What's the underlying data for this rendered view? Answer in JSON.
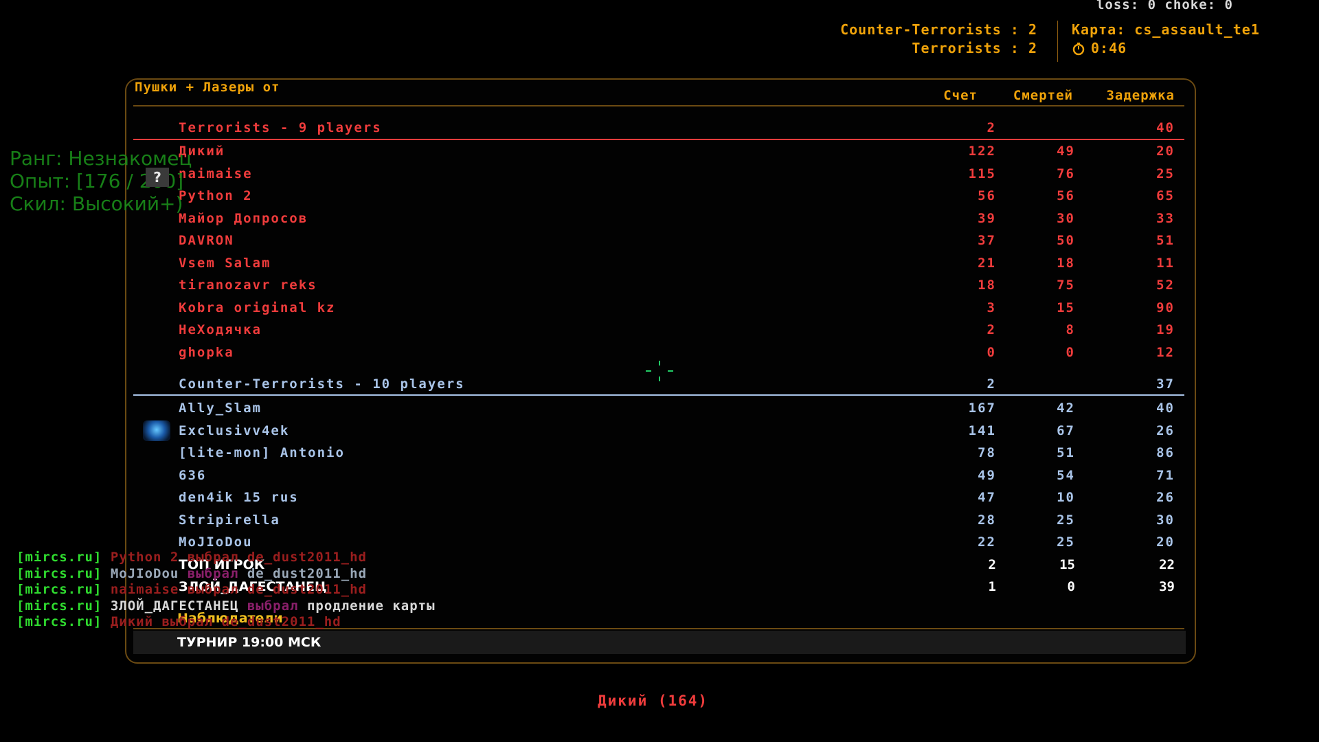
{
  "hud": {
    "net_stats": "loss: 0 choke:  0",
    "ct_count": "Counter-Terrorists : 2",
    "t_count": "Terrorists : 2",
    "map": "Карта: cs_assault_te1",
    "timer": "0:46"
  },
  "scoreboard": {
    "title": "Пушки + Лазеры от",
    "columns": {
      "score": "Счет",
      "deaths": "Смертей",
      "latency": "Задержка"
    },
    "terrorists": {
      "label": "Terrorists   -   9 players",
      "score": "2",
      "latency": "40",
      "players": [
        {
          "name": "Дикий",
          "score": "122",
          "deaths": "49",
          "latency": "20"
        },
        {
          "name": "naimaise",
          "score": "115",
          "deaths": "76",
          "latency": "25"
        },
        {
          "name": "Python 2",
          "score": "56",
          "deaths": "56",
          "latency": "65"
        },
        {
          "name": "Майор Допросов",
          "score": "39",
          "deaths": "30",
          "latency": "33"
        },
        {
          "name": "DAVRON",
          "score": "37",
          "deaths": "50",
          "latency": "51"
        },
        {
          "name": "Vsem Salam",
          "score": "21",
          "deaths": "18",
          "latency": "11"
        },
        {
          "name": "tiranozavr reks",
          "score": "18",
          "deaths": "75",
          "latency": "52"
        },
        {
          "name": "Kobra original kz",
          "score": "3",
          "deaths": "15",
          "latency": "90"
        },
        {
          "name": "НеХодячка",
          "score": "2",
          "deaths": "8",
          "latency": "19"
        },
        {
          "name": "ghopka",
          "score": "0",
          "deaths": "0",
          "latency": "12"
        }
      ]
    },
    "counter_terrorists": {
      "label": "Counter-Terrorists   -   10 players",
      "score": "2",
      "latency": "37",
      "players": [
        {
          "name": "Ally_Slam",
          "score": "167",
          "deaths": "42",
          "latency": "40"
        },
        {
          "name": "Exclusivv4ek",
          "score": "141",
          "deaths": "67",
          "latency": "26"
        },
        {
          "name": "[lite-mon] Antonio",
          "score": "78",
          "deaths": "51",
          "latency": "86"
        },
        {
          "name": "636",
          "score": "49",
          "deaths": "54",
          "latency": "71"
        },
        {
          "name": "den4ik 15 rus",
          "score": "47",
          "deaths": "10",
          "latency": "26"
        },
        {
          "name": "Stripirella",
          "score": "28",
          "deaths": "25",
          "latency": "30"
        },
        {
          "name": "MoJIoDou",
          "score": "22",
          "deaths": "25",
          "latency": "20"
        },
        {
          "name": "ТОП ИГРОК",
          "score": "2",
          "deaths": "15",
          "latency": "22"
        },
        {
          "name": "ЗЛОЙ_ДАГЕСТАНЕЦ",
          "score": "1",
          "deaths": "0",
          "latency": "39"
        }
      ]
    },
    "spectators_label": "Наблюдатели",
    "footer": "ТУРНИР 19:00 МСК"
  },
  "rank_overlay": {
    "rank": "Ранг: Незнакомец",
    "exp": "Опыт: [176 / 200]",
    "skill": "Скил: Высокий+)",
    "help": "?"
  },
  "chat": [
    {
      "tag": "[mircs.ru]",
      "parts": [
        {
          "text": " Python 2 выбрал de_dust2011_hd",
          "style": "red"
        }
      ]
    },
    {
      "tag": "[mircs.ru]",
      "parts": [
        {
          "text": " MoJIoDou",
          "style": "grey"
        },
        {
          "text": " выбрал",
          "style": "verb"
        },
        {
          "text": " de_dust2011_hd",
          "style": "grey"
        }
      ]
    },
    {
      "tag": "[mircs.ru]",
      "parts": [
        {
          "text": " naimaise выбрал de_dust2011_hd",
          "style": "red"
        }
      ]
    },
    {
      "tag": "[mircs.ru]",
      "parts": [
        {
          "text": " ЗЛОЙ_ДАГЕСТАНЕЦ",
          "style": "white"
        },
        {
          "text": " выбрал",
          "style": "verb"
        },
        {
          "text": " продление карты",
          "style": "white"
        }
      ]
    },
    {
      "tag": "[mircs.ru]",
      "parts": [
        {
          "text": " Дикий выбрал de_dust2011_hd",
          "style": "red"
        }
      ]
    }
  ],
  "spectating": "Дикий (164)",
  "colors": {
    "terrorist": "#f03c3c",
    "ct": "#a9c4e8",
    "accent": "#f0a30a",
    "chat_tag": "#2fdc2f"
  }
}
